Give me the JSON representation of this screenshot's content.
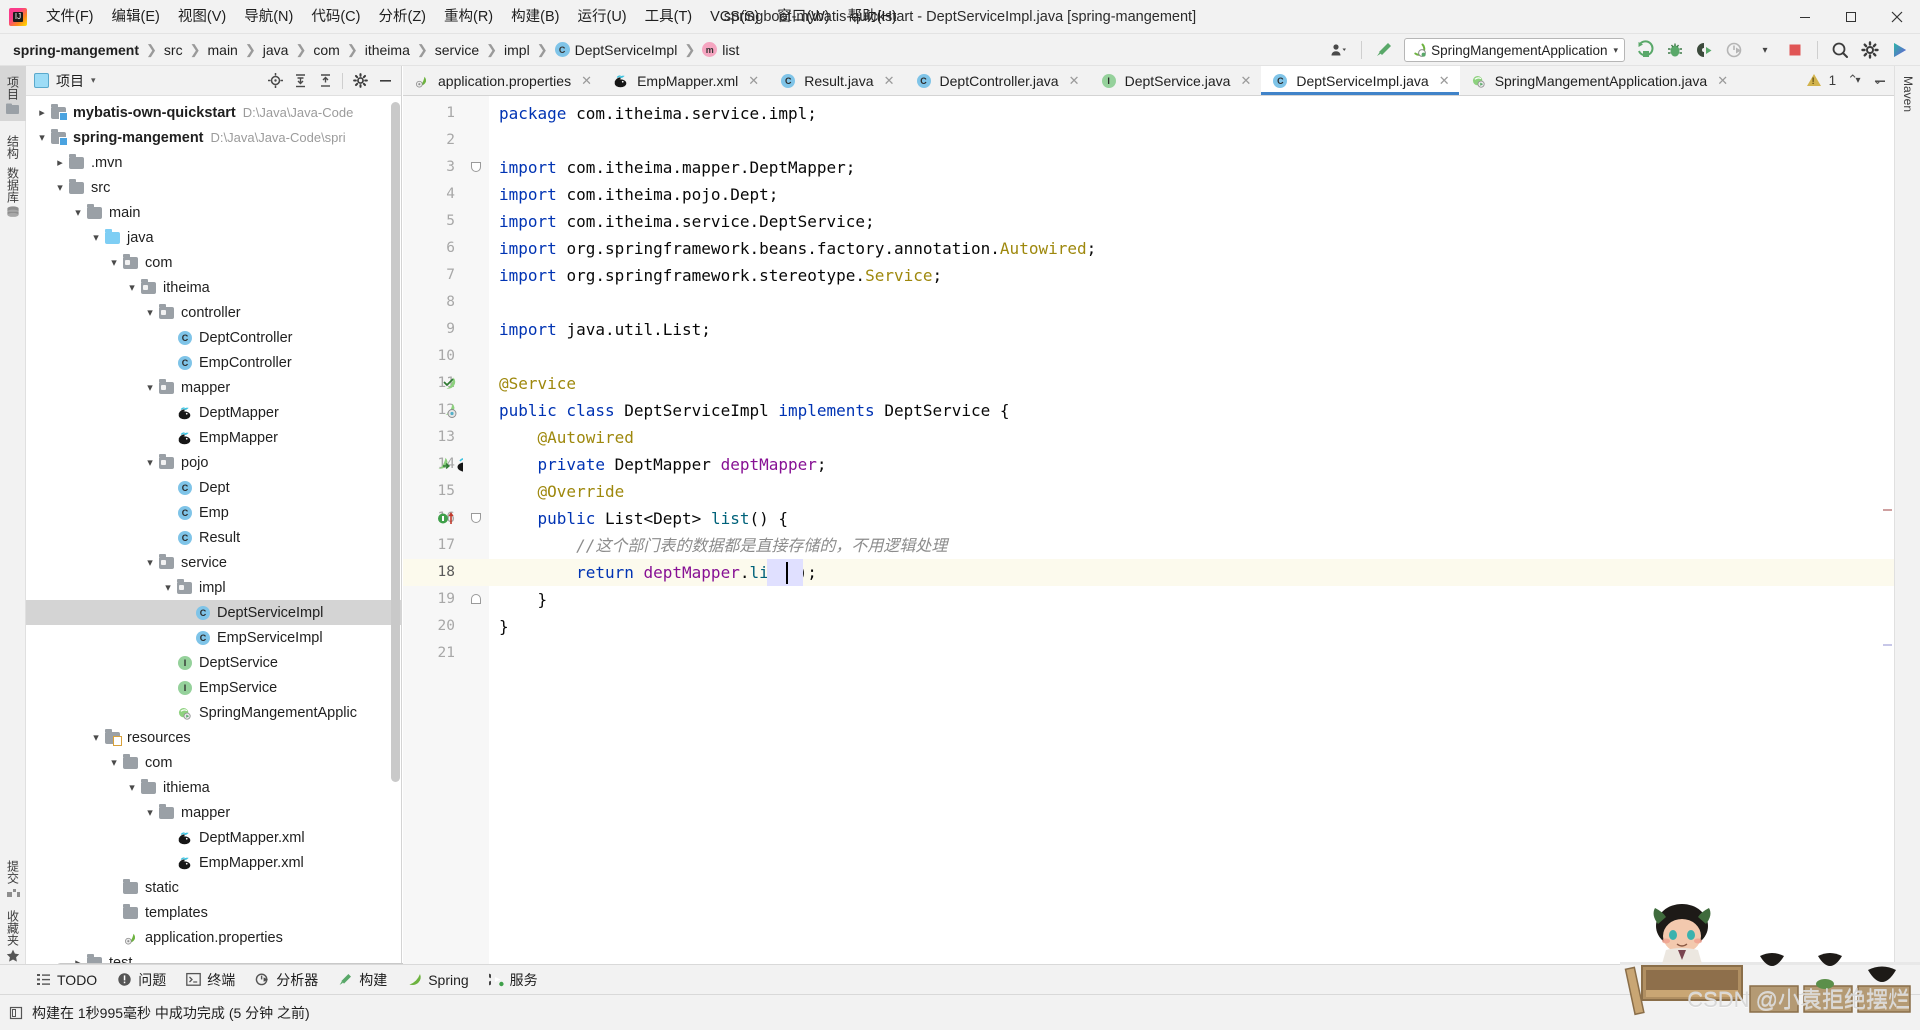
{
  "window": {
    "title": "springboot-mybatis-quickstart - DeptServiceImpl.java [spring-mangement]",
    "minimize_label": "–",
    "maximize_label": "❐",
    "close_label": "✕"
  },
  "menu": {
    "logo_name": "intellij-idea-logo",
    "items": [
      {
        "label": "文件(F)",
        "name": "menu-file"
      },
      {
        "label": "编辑(E)",
        "name": "menu-edit"
      },
      {
        "label": "视图(V)",
        "name": "menu-view"
      },
      {
        "label": "导航(N)",
        "name": "menu-navigate"
      },
      {
        "label": "代码(C)",
        "name": "menu-code"
      },
      {
        "label": "分析(Z)",
        "name": "menu-analyze"
      },
      {
        "label": "重构(R)",
        "name": "menu-refactor"
      },
      {
        "label": "构建(B)",
        "name": "menu-build"
      },
      {
        "label": "运行(U)",
        "name": "menu-run"
      },
      {
        "label": "工具(T)",
        "name": "menu-tools"
      },
      {
        "label": "VCS(S)",
        "name": "menu-vcs"
      },
      {
        "label": "窗口(W)",
        "name": "menu-window"
      },
      {
        "label": "帮助(H)",
        "name": "menu-help"
      }
    ]
  },
  "breadcrumb": {
    "items": [
      {
        "label": "spring-mangement",
        "icon": "",
        "bold": true,
        "name": "breadcrumb-project"
      },
      {
        "label": "src",
        "icon": "",
        "bold": false,
        "name": "breadcrumb-src"
      },
      {
        "label": "main",
        "icon": "",
        "bold": false,
        "name": "breadcrumb-main"
      },
      {
        "label": "java",
        "icon": "",
        "bold": false,
        "name": "breadcrumb-java"
      },
      {
        "label": "com",
        "icon": "",
        "bold": false,
        "name": "breadcrumb-com"
      },
      {
        "label": "itheima",
        "icon": "",
        "bold": false,
        "name": "breadcrumb-itheima"
      },
      {
        "label": "service",
        "icon": "",
        "bold": false,
        "name": "breadcrumb-service"
      },
      {
        "label": "impl",
        "icon": "",
        "bold": false,
        "name": "breadcrumb-impl"
      },
      {
        "label": "DeptServiceImpl",
        "icon": "class",
        "bold": false,
        "name": "breadcrumb-class"
      },
      {
        "label": "list",
        "icon": "method",
        "bold": false,
        "name": "breadcrumb-method"
      }
    ],
    "separator": "❯"
  },
  "toolbar": {
    "run_config_name": "SpringMangementApplication",
    "run_config_caret": "▾",
    "icons": [
      {
        "name": "user-settings-icon",
        "title": "用户"
      },
      {
        "name": "build-hammer-icon",
        "title": "构建"
      },
      {
        "name": "run-icon",
        "title": "运行"
      },
      {
        "name": "debug-icon",
        "title": "调试"
      },
      {
        "name": "run-with-coverage-icon",
        "title": "运行并覆盖"
      },
      {
        "name": "profiler-icon",
        "title": "分析器"
      },
      {
        "name": "stop-icon",
        "title": "停止"
      },
      {
        "name": "search-everywhere-icon",
        "title": "搜索"
      },
      {
        "name": "settings-gear-icon",
        "title": "设置"
      },
      {
        "name": "updates-icon",
        "title": "更新"
      }
    ]
  },
  "left_stripe": [
    {
      "label": "项目",
      "name": "stripe-project",
      "active": true,
      "icon": "project-icon"
    },
    {
      "label": "结构",
      "name": "stripe-structure",
      "active": false,
      "icon": "structure-icon"
    },
    {
      "label": "数据库",
      "name": "stripe-database",
      "active": false,
      "icon": "database-icon"
    },
    {
      "label": "提交",
      "name": "stripe-commit",
      "active": false,
      "icon": "commit-icon"
    },
    {
      "label": "收藏夹",
      "name": "stripe-favorites",
      "active": false,
      "icon": "star-icon"
    }
  ],
  "right_stripe": [
    {
      "label": "Maven",
      "name": "stripe-maven",
      "icon": "maven-icon"
    }
  ],
  "project_panel": {
    "title": "项目",
    "caret": "▾",
    "tools": [
      {
        "name": "scroll-from-source-icon",
        "title": "定位"
      },
      {
        "name": "expand-all-icon",
        "title": "全部展开"
      },
      {
        "name": "collapse-all-icon",
        "title": "全部折叠"
      },
      {
        "name": "panel-settings-gear-icon",
        "title": "设置"
      },
      {
        "name": "hide-panel-icon",
        "title": "隐藏"
      }
    ],
    "tree": [
      {
        "depth": 0,
        "label": "mybatis-own-quickstart",
        "path": "D:\\Java\\Java-Code",
        "icon": "module",
        "twisty": "collapsed",
        "bold": true,
        "name": "tree-node-mybatis-own-quickstart"
      },
      {
        "depth": 0,
        "label": "spring-mangement",
        "path": "D:\\Java\\Java-Code\\spri",
        "icon": "module",
        "twisty": "expanded",
        "bold": true,
        "name": "tree-node-spring-mangement"
      },
      {
        "depth": 1,
        "label": ".mvn",
        "path": "",
        "icon": "folder",
        "twisty": "collapsed",
        "bold": false,
        "name": "tree-node-mvn"
      },
      {
        "depth": 1,
        "label": "src",
        "path": "",
        "icon": "folder",
        "twisty": "expanded",
        "bold": false,
        "name": "tree-node-src"
      },
      {
        "depth": 2,
        "label": "main",
        "path": "",
        "icon": "folder",
        "twisty": "expanded",
        "bold": false,
        "name": "tree-node-main"
      },
      {
        "depth": 3,
        "label": "java",
        "path": "",
        "icon": "folder-blue",
        "twisty": "expanded",
        "bold": false,
        "name": "tree-node-java"
      },
      {
        "depth": 4,
        "label": "com",
        "path": "",
        "icon": "package",
        "twisty": "expanded",
        "bold": false,
        "name": "tree-node-com"
      },
      {
        "depth": 5,
        "label": "itheima",
        "path": "",
        "icon": "package",
        "twisty": "expanded",
        "bold": false,
        "name": "tree-node-itheima"
      },
      {
        "depth": 6,
        "label": "controller",
        "path": "",
        "icon": "package",
        "twisty": "expanded",
        "bold": false,
        "name": "tree-node-controller"
      },
      {
        "depth": 7,
        "label": "DeptController",
        "path": "",
        "icon": "class",
        "twisty": "none",
        "bold": false,
        "name": "tree-node-deptcontroller"
      },
      {
        "depth": 7,
        "label": "EmpController",
        "path": "",
        "icon": "class",
        "twisty": "none",
        "bold": false,
        "name": "tree-node-empcontroller"
      },
      {
        "depth": 6,
        "label": "mapper",
        "path": "",
        "icon": "package",
        "twisty": "expanded",
        "bold": false,
        "name": "tree-node-mapper"
      },
      {
        "depth": 7,
        "label": "DeptMapper",
        "path": "",
        "icon": "mybatis",
        "twisty": "none",
        "bold": false,
        "name": "tree-node-deptmapper"
      },
      {
        "depth": 7,
        "label": "EmpMapper",
        "path": "",
        "icon": "mybatis",
        "twisty": "none",
        "bold": false,
        "name": "tree-node-empmapper"
      },
      {
        "depth": 6,
        "label": "pojo",
        "path": "",
        "icon": "package",
        "twisty": "expanded",
        "bold": false,
        "name": "tree-node-pojo"
      },
      {
        "depth": 7,
        "label": "Dept",
        "path": "",
        "icon": "class",
        "twisty": "none",
        "bold": false,
        "name": "tree-node-dept"
      },
      {
        "depth": 7,
        "label": "Emp",
        "path": "",
        "icon": "class",
        "twisty": "none",
        "bold": false,
        "name": "tree-node-emp"
      },
      {
        "depth": 7,
        "label": "Result",
        "path": "",
        "icon": "class",
        "twisty": "none",
        "bold": false,
        "name": "tree-node-result"
      },
      {
        "depth": 6,
        "label": "service",
        "path": "",
        "icon": "package",
        "twisty": "expanded",
        "bold": false,
        "name": "tree-node-service"
      },
      {
        "depth": 7,
        "label": "impl",
        "path": "",
        "icon": "package",
        "twisty": "expanded",
        "bold": false,
        "name": "tree-node-impl"
      },
      {
        "depth": 8,
        "label": "DeptServiceImpl",
        "path": "",
        "icon": "class",
        "twisty": "none",
        "bold": false,
        "selected": true,
        "name": "tree-node-deptserviceimpl"
      },
      {
        "depth": 8,
        "label": "EmpServiceImpl",
        "path": "",
        "icon": "class",
        "twisty": "none",
        "bold": false,
        "name": "tree-node-empserviceimpl"
      },
      {
        "depth": 7,
        "label": "DeptService",
        "path": "",
        "icon": "interface",
        "twisty": "none",
        "bold": false,
        "name": "tree-node-deptservice"
      },
      {
        "depth": 7,
        "label": "EmpService",
        "path": "",
        "icon": "interface",
        "twisty": "none",
        "bold": false,
        "name": "tree-node-empservice"
      },
      {
        "depth": 7,
        "label": "SpringMangementApplic",
        "path": "",
        "icon": "spring-app",
        "twisty": "none",
        "bold": false,
        "name": "tree-node-springmangementapplication"
      },
      {
        "depth": 3,
        "label": "resources",
        "path": "",
        "icon": "folder-resources",
        "twisty": "expanded",
        "bold": false,
        "name": "tree-node-resources"
      },
      {
        "depth": 4,
        "label": "com",
        "path": "",
        "icon": "folder",
        "twisty": "expanded",
        "bold": false,
        "name": "tree-node-res-com"
      },
      {
        "depth": 5,
        "label": "ithiema",
        "path": "",
        "icon": "folder",
        "twisty": "expanded",
        "bold": false,
        "name": "tree-node-res-ithiema"
      },
      {
        "depth": 6,
        "label": "mapper",
        "path": "",
        "icon": "folder",
        "twisty": "expanded",
        "bold": false,
        "name": "tree-node-res-mapper"
      },
      {
        "depth": 7,
        "label": "DeptMapper.xml",
        "path": "",
        "icon": "mybatis",
        "twisty": "none",
        "bold": false,
        "name": "tree-node-deptmapper-xml"
      },
      {
        "depth": 7,
        "label": "EmpMapper.xml",
        "path": "",
        "icon": "mybatis",
        "twisty": "none",
        "bold": false,
        "name": "tree-node-empmapper-xml"
      },
      {
        "depth": 4,
        "label": "static",
        "path": "",
        "icon": "folder",
        "twisty": "none",
        "bold": false,
        "name": "tree-node-static"
      },
      {
        "depth": 4,
        "label": "templates",
        "path": "",
        "icon": "folder",
        "twisty": "none",
        "bold": false,
        "name": "tree-node-templates"
      },
      {
        "depth": 4,
        "label": "application.properties",
        "path": "",
        "icon": "spring-props",
        "twisty": "none",
        "bold": false,
        "name": "tree-node-application-properties"
      },
      {
        "depth": 2,
        "label": "test",
        "path": "",
        "icon": "folder",
        "twisty": "collapsed",
        "bold": false,
        "name": "tree-node-test"
      }
    ]
  },
  "editor": {
    "tabs": [
      {
        "label": "application.properties",
        "icon": "spring-props",
        "active": false,
        "name": "tab-application-properties"
      },
      {
        "label": "EmpMapper.xml",
        "icon": "mybatis",
        "active": false,
        "name": "tab-empmapper-xml"
      },
      {
        "label": "Result.java",
        "icon": "class",
        "active": false,
        "name": "tab-result-java"
      },
      {
        "label": "DeptController.java",
        "icon": "class",
        "active": false,
        "name": "tab-deptcontroller-java"
      },
      {
        "label": "DeptService.java",
        "icon": "interface",
        "active": false,
        "name": "tab-deptservice-java"
      },
      {
        "label": "DeptServiceImpl.java",
        "icon": "class",
        "active": true,
        "name": "tab-deptserviceimpl-java"
      },
      {
        "label": "SpringMangementApplication.java",
        "icon": "spring-app",
        "active": false,
        "name": "tab-springmangementapplication-java"
      }
    ],
    "tab_close_glyph": "✕",
    "inspection": {
      "warning_count": "1",
      "prev_glyph": "⌃",
      "next_glyph": "⌄"
    },
    "current_line": 18,
    "lines": [
      {
        "n": 1,
        "tokens": [
          {
            "t": "package ",
            "c": "kw"
          },
          {
            "t": "com.itheima.service.impl;",
            "c": ""
          }
        ]
      },
      {
        "n": 2,
        "tokens": []
      },
      {
        "n": 3,
        "tokens": [
          {
            "t": "import ",
            "c": "kw"
          },
          {
            "t": "com.itheima.mapper.DeptMapper;",
            "c": ""
          }
        ]
      },
      {
        "n": 4,
        "tokens": [
          {
            "t": "import ",
            "c": "kw"
          },
          {
            "t": "com.itheima.pojo.Dept;",
            "c": ""
          }
        ]
      },
      {
        "n": 5,
        "tokens": [
          {
            "t": "import ",
            "c": "kw"
          },
          {
            "t": "com.itheima.service.DeptService;",
            "c": ""
          }
        ]
      },
      {
        "n": 6,
        "tokens": [
          {
            "t": "import ",
            "c": "kw"
          },
          {
            "t": "org.springframework.beans.factory.annotation.",
            "c": ""
          },
          {
            "t": "Autowired",
            "c": "ann"
          },
          {
            "t": ";",
            "c": ""
          }
        ]
      },
      {
        "n": 7,
        "tokens": [
          {
            "t": "import ",
            "c": "kw"
          },
          {
            "t": "org.springframework.stereotype.",
            "c": ""
          },
          {
            "t": "Service",
            "c": "ann"
          },
          {
            "t": ";",
            "c": ""
          }
        ]
      },
      {
        "n": 8,
        "tokens": []
      },
      {
        "n": 9,
        "tokens": [
          {
            "t": "import ",
            "c": "kw"
          },
          {
            "t": "java.util.List;",
            "c": ""
          }
        ]
      },
      {
        "n": 10,
        "tokens": []
      },
      {
        "n": 11,
        "tokens": [
          {
            "t": "@Service",
            "c": "ann"
          }
        ]
      },
      {
        "n": 12,
        "tokens": [
          {
            "t": "public class ",
            "c": "kw"
          },
          {
            "t": "DeptServiceImpl ",
            "c": ""
          },
          {
            "t": "implements ",
            "c": "kw"
          },
          {
            "t": "DeptService {",
            "c": ""
          }
        ]
      },
      {
        "n": 13,
        "tokens": [
          {
            "t": "    @Autowired",
            "c": "ann"
          }
        ]
      },
      {
        "n": 14,
        "tokens": [
          {
            "t": "    ",
            "c": ""
          },
          {
            "t": "private ",
            "c": "kw"
          },
          {
            "t": "DeptMapper ",
            "c": ""
          },
          {
            "t": "deptMapper",
            "c": "fld"
          },
          {
            "t": ";",
            "c": ""
          }
        ]
      },
      {
        "n": 15,
        "tokens": [
          {
            "t": "    @Override",
            "c": "ann"
          }
        ]
      },
      {
        "n": 16,
        "tokens": [
          {
            "t": "    ",
            "c": ""
          },
          {
            "t": "public ",
            "c": "kw"
          },
          {
            "t": "List<Dept> ",
            "c": ""
          },
          {
            "t": "list",
            "c": "mth"
          },
          {
            "t": "() {",
            "c": ""
          }
        ]
      },
      {
        "n": 17,
        "tokens": [
          {
            "t": "        //这个部门表的数据都是直接存储的，不用逻辑处理",
            "c": "cmt"
          }
        ]
      },
      {
        "n": 18,
        "tokens": [
          {
            "t": "        ",
            "c": ""
          },
          {
            "t": "return ",
            "c": "kw"
          },
          {
            "t": "deptMapper",
            "c": "fld"
          },
          {
            "t": ".",
            "c": ""
          },
          {
            "t": "list",
            "c": "mth"
          },
          {
            "t": "();",
            "c": ""
          }
        ]
      },
      {
        "n": 19,
        "tokens": [
          {
            "t": "    }",
            "c": ""
          }
        ]
      },
      {
        "n": 20,
        "tokens": [
          {
            "t": "}",
            "c": ""
          }
        ]
      },
      {
        "n": 21,
        "tokens": []
      }
    ],
    "gutter_icons": [
      {
        "line": 11,
        "name": "spring-bean-icon"
      },
      {
        "line": 12,
        "name": "spring-bean-class-icon"
      },
      {
        "line": 14,
        "name": "spring-autowired-icon"
      },
      {
        "line": 14,
        "name": "mybatis-mapper-icon"
      },
      {
        "line": 16,
        "name": "implementing-method-icon"
      }
    ]
  },
  "bottom_tools": [
    {
      "label": "TODO",
      "name": "bottom-tool-todo",
      "icon": "todo-icon"
    },
    {
      "label": "问题",
      "name": "bottom-tool-problems",
      "icon": "problems-icon"
    },
    {
      "label": "终端",
      "name": "bottom-tool-terminal",
      "icon": "terminal-icon"
    },
    {
      "label": "分析器",
      "name": "bottom-tool-profiler",
      "icon": "profiler-icon"
    },
    {
      "label": "构建",
      "name": "bottom-tool-build",
      "icon": "build-icon"
    },
    {
      "label": "Spring",
      "name": "bottom-tool-spring",
      "icon": "spring-leaf-icon"
    },
    {
      "label": "服务",
      "name": "bottom-tool-services",
      "icon": "services-icon"
    }
  ],
  "status_bar": {
    "message": "构建在 1秒995毫秒 中成功完成 (5 分钟 之前)",
    "icon_name": "build-status-icon"
  },
  "overlay": {
    "watermark": "CSDN @小袁拒绝摆烂",
    "art_name": "pixel-art-character-overlay"
  },
  "colors": {
    "accent": "#4083c9",
    "keyword": "#0033b3",
    "annotation": "#9e880d",
    "field": "#871094",
    "method": "#00627a",
    "comment": "#8c8c8c",
    "selection": "#d4d4d4",
    "current_line": "#fcfaed"
  }
}
